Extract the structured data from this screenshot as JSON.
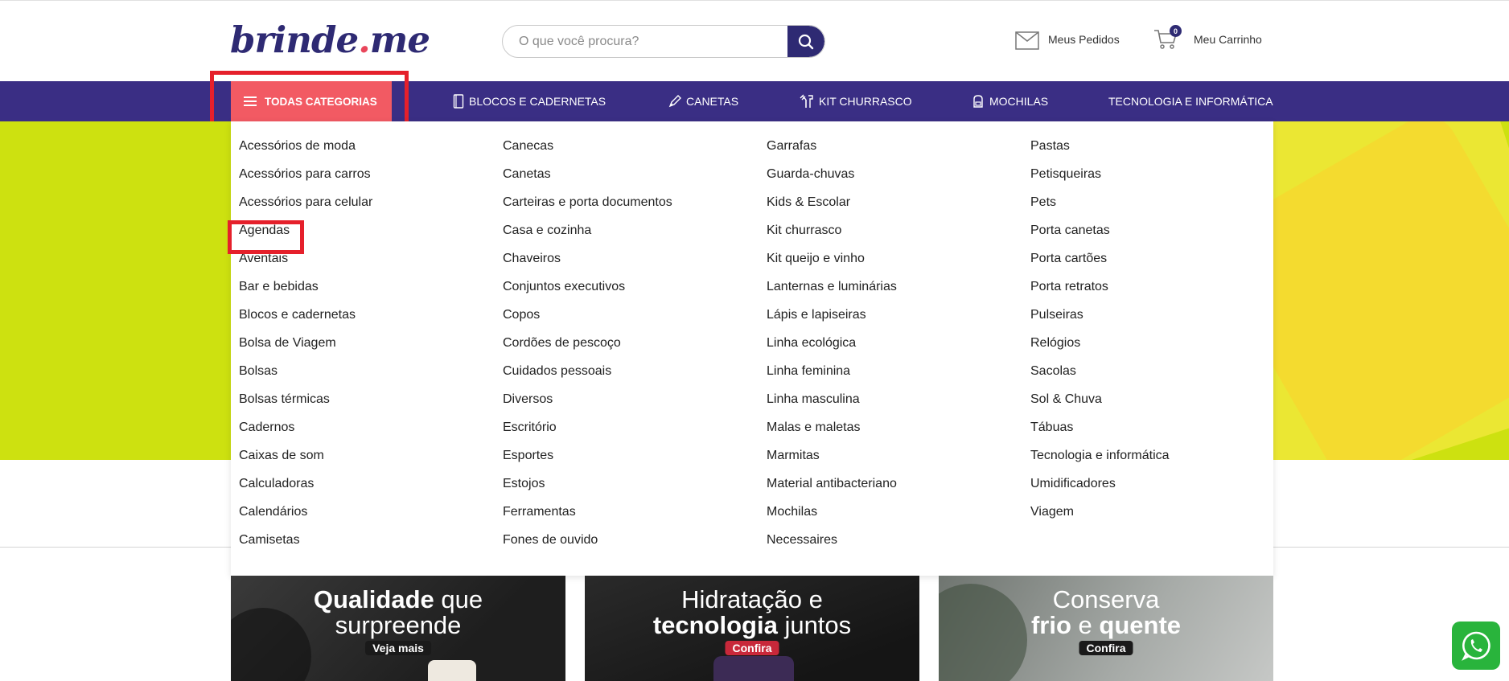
{
  "header": {
    "logo_main": "brinde",
    "logo_dot": ".",
    "logo_tld": "me",
    "search_placeholder": "O que você procura?",
    "orders_label": "Meus Pedidos",
    "cart_label": "Meu Carrinho",
    "cart_count": "0"
  },
  "nav": {
    "all_categories": "TODAS CATEGORIAS",
    "items": [
      {
        "label": "BLOCOS E CADERNETAS",
        "icon": "notebook-icon"
      },
      {
        "label": "CANETAS",
        "icon": "pen-icon"
      },
      {
        "label": "KIT CHURRASCO",
        "icon": "grill-tools-icon"
      },
      {
        "label": "MOCHILAS",
        "icon": "backpack-icon"
      },
      {
        "label": "TECNOLOGIA E INFORMÁTICA",
        "icon": ""
      }
    ]
  },
  "categories": {
    "col1": [
      "Acessórios de moda",
      "Acessórios para carros",
      "Acessórios para celular",
      "Agendas",
      "Aventais",
      "Bar e bebidas",
      "Blocos e cadernetas",
      "Bolsa de Viagem",
      "Bolsas",
      "Bolsas térmicas",
      "Cadernos",
      "Caixas de som",
      "Calculadoras",
      "Calendários",
      "Camisetas"
    ],
    "col2": [
      "Canecas",
      "Canetas",
      "Carteiras e porta documentos",
      "Casa e cozinha",
      "Chaveiros",
      "Conjuntos executivos",
      "Copos",
      "Cordões de pescoço",
      "Cuidados pessoais",
      "Diversos",
      "Escritório",
      "Esportes",
      "Estojos",
      "Ferramentas",
      "Fones de ouvido"
    ],
    "col3": [
      "Garrafas",
      "Guarda-chuvas",
      "Kids & Escolar",
      "Kit churrasco",
      "Kit queijo e vinho",
      "Lanternas e luminárias",
      "Lápis e lapiseiras",
      "Linha ecológica",
      "Linha feminina",
      "Linha masculina",
      "Malas e maletas",
      "Marmitas",
      "Material antibacteriano",
      "Mochilas",
      "Necessaires"
    ],
    "col4": [
      "Pastas",
      "Petisqueiras",
      "Pets",
      "Porta canetas",
      "Porta cartões",
      "Porta retratos",
      "Pulseiras",
      "Relógios",
      "Sacolas",
      "Sol & Chuva",
      "Tábuas",
      "Tecnologia e informática",
      "Umidificadores",
      "Viagem"
    ]
  },
  "promos": [
    {
      "line1_bold": "Qualidade",
      "line1_rest": " que",
      "line2": "surpreende",
      "cta": "Veja mais",
      "cta_color": "#1a1a1a",
      "bg": "#2a2a2a"
    },
    {
      "line1_bold": "",
      "line1_rest": "Hidratação e",
      "line2_bold": "tecnologia",
      "line2_rest": " juntos",
      "cta": "Confira",
      "cta_color": "#c8283a",
      "bg": "#222222"
    },
    {
      "line1_rest": "Conserva",
      "line2_bold": "frio",
      "line2_mid": " e ",
      "line2_bold2": "quente",
      "cta": "Confira",
      "cta_color": "#1a1a1a",
      "bg": "#8d9290"
    }
  ],
  "colors": {
    "brand": "#2e2a73",
    "nav_bg": "#3a2e84",
    "accent": "#f25a63",
    "hero": "#cde110",
    "highlight": "#e5202b"
  }
}
